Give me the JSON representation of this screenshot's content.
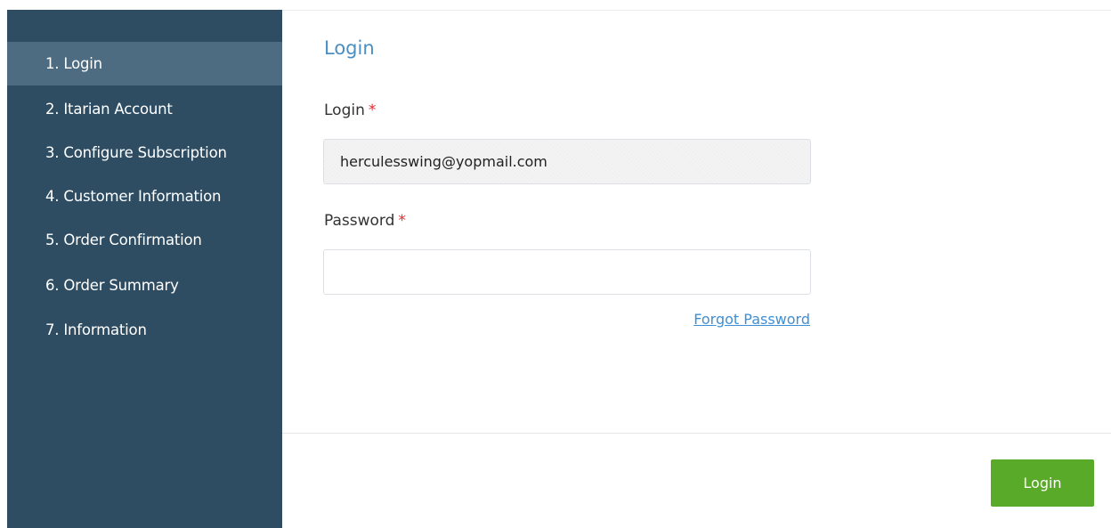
{
  "sidebar": {
    "steps": [
      {
        "label": "1. Login",
        "active": true
      },
      {
        "label": "2. Itarian Account",
        "active": false
      },
      {
        "label": "3. Configure Subscription",
        "active": false
      },
      {
        "label": "4. Customer Information",
        "active": false
      },
      {
        "label": "5. Order Confirmation",
        "active": false
      },
      {
        "label": "6. Order Summary",
        "active": false
      },
      {
        "label": "7. Information",
        "active": false
      }
    ]
  },
  "main": {
    "title": "Login",
    "login_field": {
      "label": "Login",
      "required_marker": "*",
      "value": "herculesswing@yopmail.com"
    },
    "password_field": {
      "label": "Password",
      "required_marker": "*",
      "value": ""
    },
    "forgot_password": "Forgot Password"
  },
  "footer": {
    "login_button": "Login"
  },
  "colors": {
    "sidebar_bg": "#2e4d62",
    "sidebar_active": "#4e6c81",
    "title_accent": "#4a8fc2",
    "required": "#e32b2b",
    "link": "#3f8fd6",
    "button": "#5aaa2a"
  }
}
